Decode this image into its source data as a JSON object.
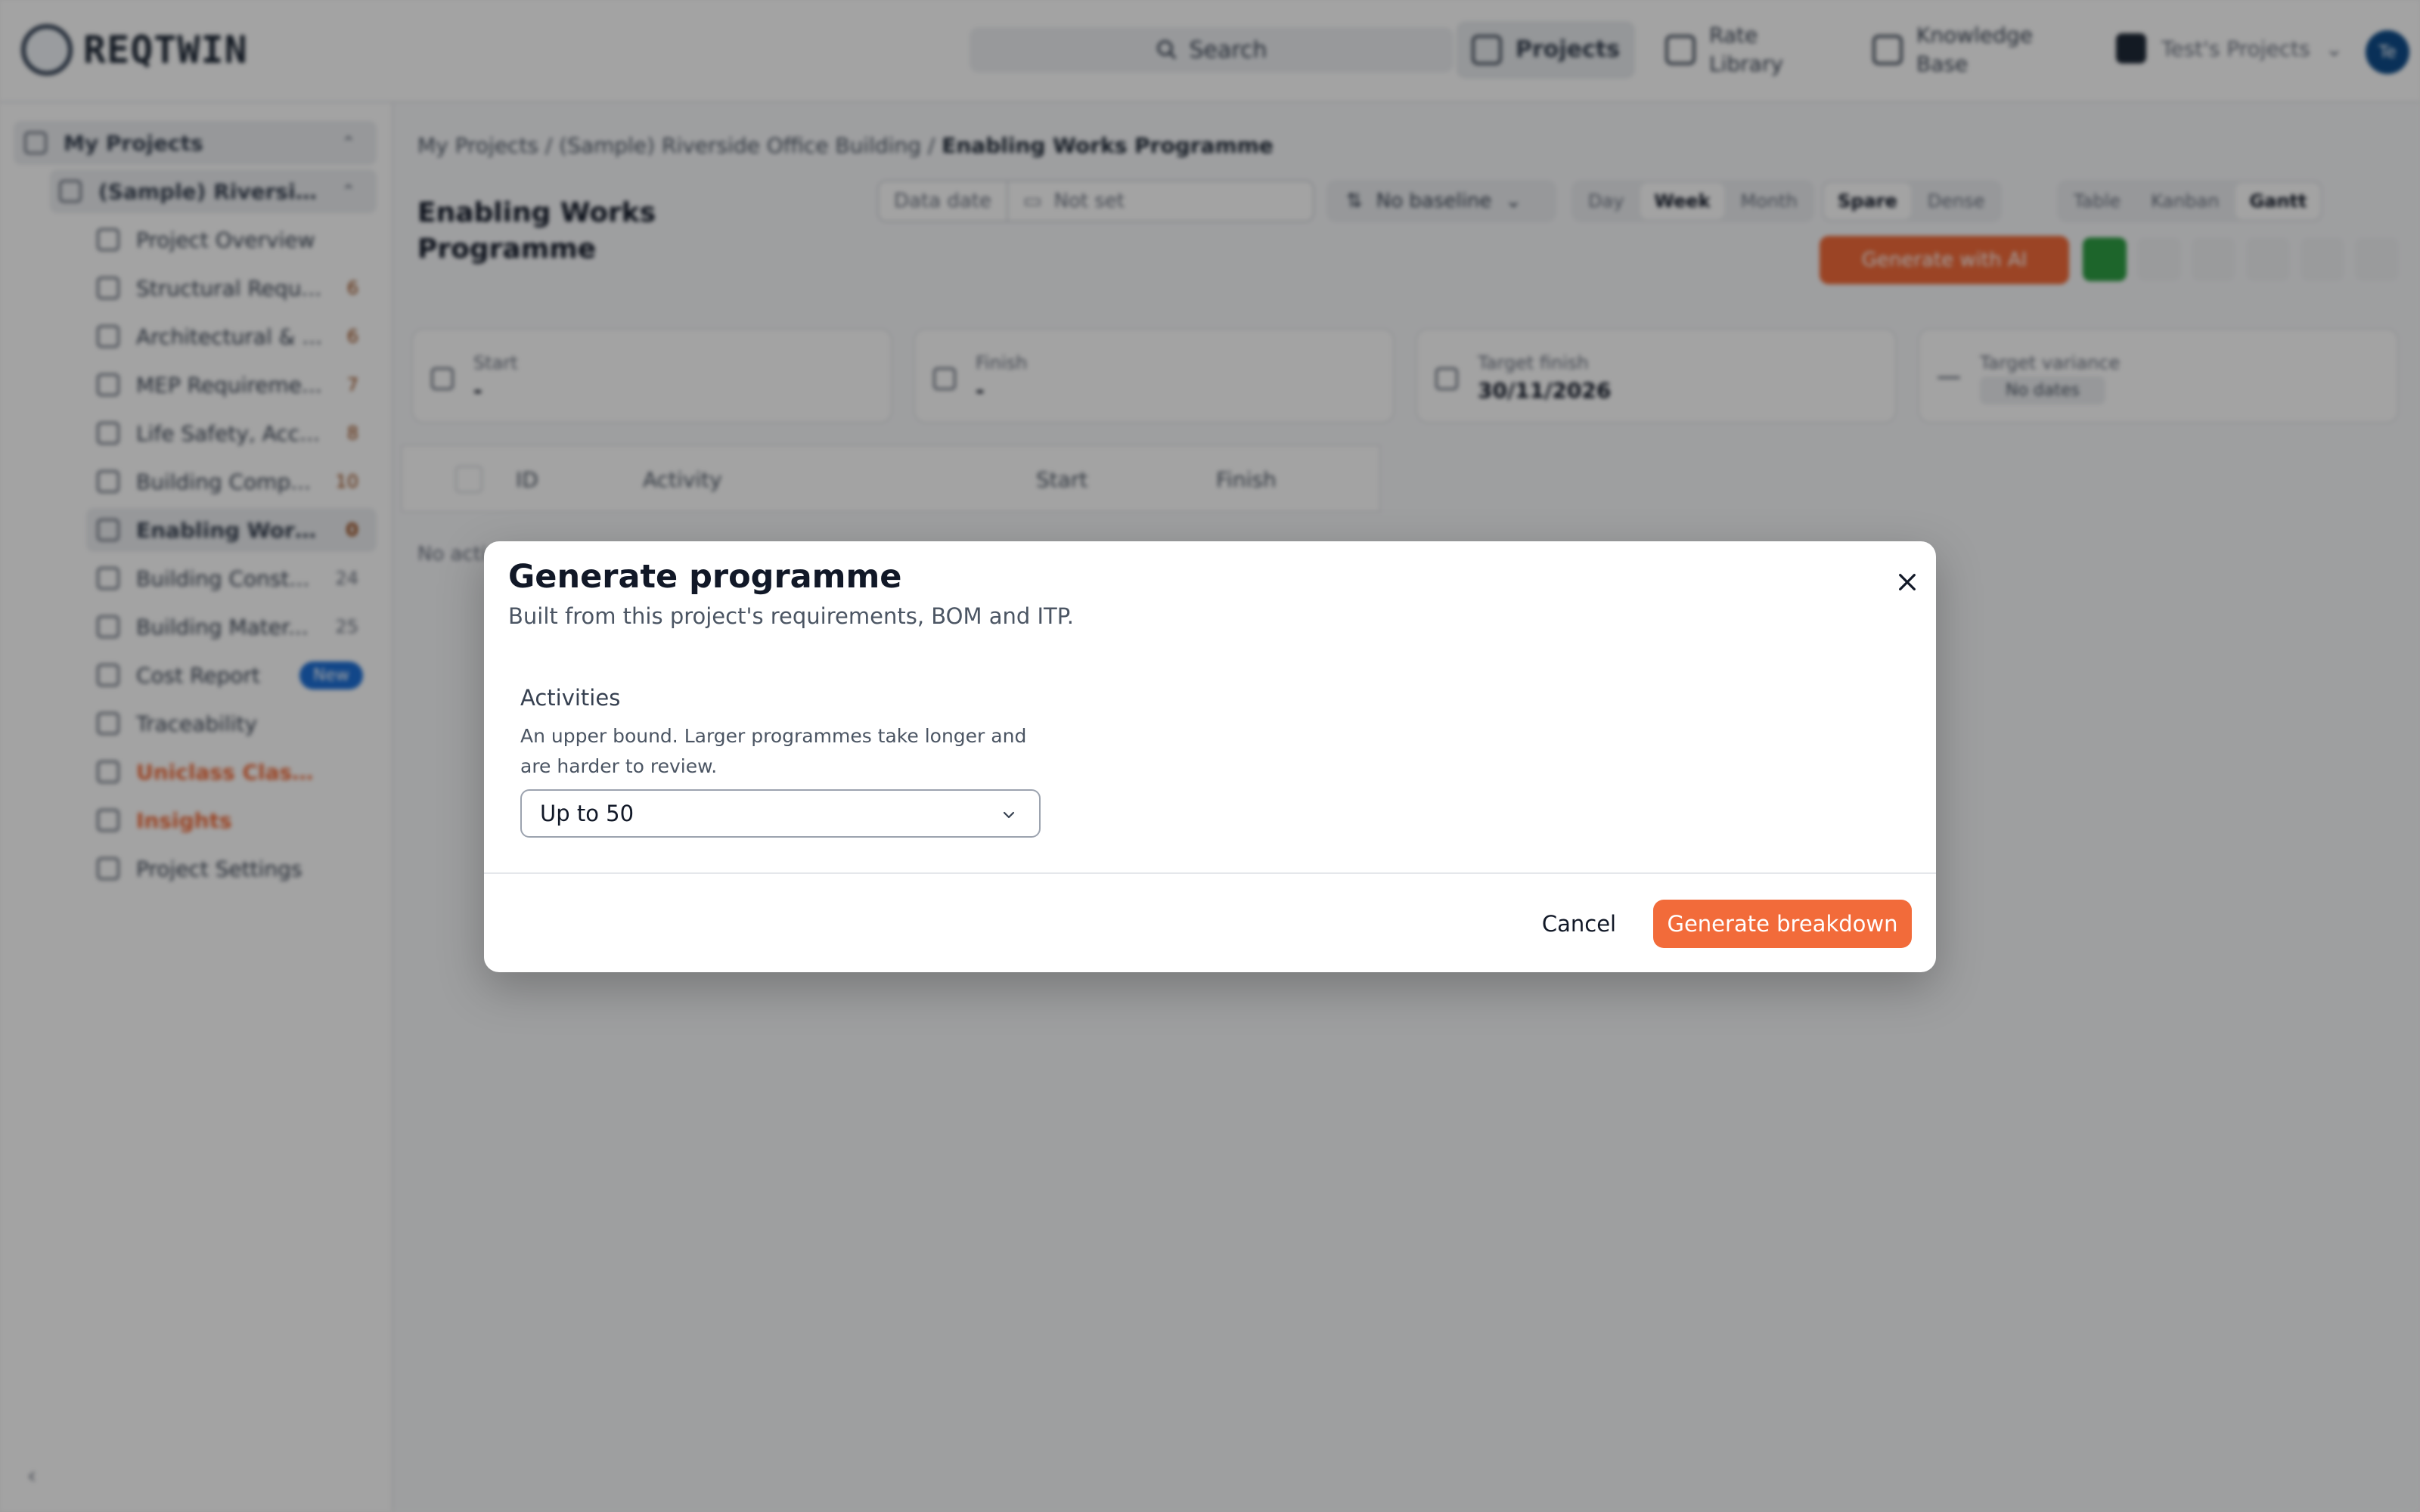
{
  "app": {
    "logo_text": "REQTWIN"
  },
  "topbar": {
    "search_label": "Search",
    "nav": {
      "projects": "Projects",
      "rate_library": "Rate Library",
      "knowledge_base": "Knowledge Base"
    },
    "org_label": "Test's Projects",
    "avatar_initials": "Te"
  },
  "sidebar": {
    "root": "My Projects",
    "project": "(Sample) Riverside...",
    "items": [
      {
        "label": "Project Overview",
        "count": ""
      },
      {
        "label": "Structural Requ...",
        "count": "6"
      },
      {
        "label": "Architectural & ...",
        "count": "6"
      },
      {
        "label": "MEP Requireme...",
        "count": "7"
      },
      {
        "label": "Life Safety, Acc...",
        "count": "8"
      },
      {
        "label": "Building Comp...",
        "count": "10"
      },
      {
        "label": "Enabling Works...",
        "count": "0"
      },
      {
        "label": "Building Const...",
        "count": "24"
      },
      {
        "label": "Building Mater...",
        "count": "25"
      },
      {
        "label": "Cost Report",
        "count": "",
        "badge": "New"
      },
      {
        "label": "Traceability",
        "count": ""
      },
      {
        "label": "Uniclass Classific...",
        "count": ""
      },
      {
        "label": "Insights",
        "count": ""
      },
      {
        "label": "Project Settings",
        "count": ""
      }
    ]
  },
  "main": {
    "breadcrumb": {
      "part1": "My Projects / (Sample) Riverside Office Building / ",
      "current": "Enabling Works Programme"
    },
    "title": "Enabling Works Programme",
    "data_date_label": "Data date",
    "data_date_value": "Not set",
    "baseline": "No baseline",
    "scale": [
      "Day",
      "Week",
      "Month"
    ],
    "density": [
      "Spare",
      "Dense"
    ],
    "views": [
      "Table",
      "Kanban",
      "Gantt"
    ],
    "generate_ai": "Generate with AI",
    "cards": {
      "start_label": "Start",
      "start_value": "-",
      "finish_label": "Finish",
      "finish_value": "-",
      "target_label": "Target finish",
      "target_value": "30/11/2026",
      "variance_label": "Target variance",
      "variance_value": "No dates"
    },
    "columns": [
      "ID",
      "Activity",
      "Start",
      "Finish"
    ],
    "empty_text": "No acti"
  },
  "modal": {
    "title": "Generate programme",
    "subtitle": "Built from this project's requirements, BOM and ITP.",
    "field_label": "Activities",
    "field_help": "An upper bound. Larger programmes take longer and are harder to review.",
    "select_value": "Up to 50",
    "cancel": "Cancel",
    "submit": "Generate breakdown"
  },
  "colors": {
    "accent": "#f26b3a",
    "overlay": "rgba(0,0,0,0.36)",
    "badge": "#1d6fd6",
    "green": "#2e9e44"
  }
}
